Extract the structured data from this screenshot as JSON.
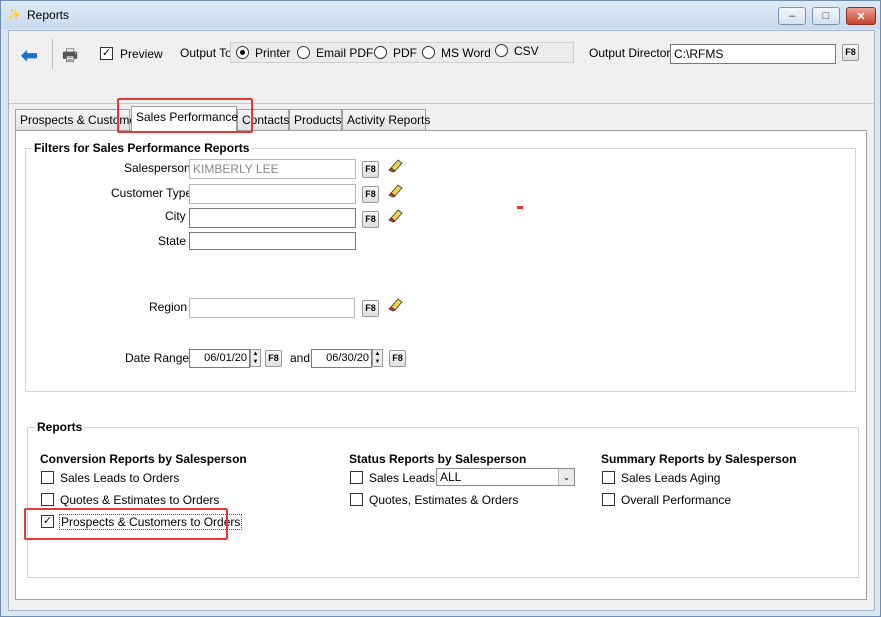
{
  "window": {
    "title": "Reports"
  },
  "toolbar": {
    "preview_label": "Preview",
    "preview_checked": true,
    "output_to_label": "Output To",
    "output_options": [
      "Printer",
      "Email PDF",
      "PDF",
      "MS Word",
      "CSV"
    ],
    "output_selected": "Printer",
    "output_dir_label": "Output Directory",
    "output_dir_value": "C:\\RFMS",
    "f8_label": "F8"
  },
  "tabs": [
    {
      "label": "Prospects & Customers"
    },
    {
      "label": "Sales Performance",
      "active": true
    },
    {
      "label": "Contacts"
    },
    {
      "label": "Products"
    },
    {
      "label": "Activity Reports"
    }
  ],
  "filters": {
    "title": "Filters for Sales Performance Reports",
    "salesperson_label": "Salesperson",
    "salesperson_value": "KIMBERLY LEE",
    "customer_type_label": "Customer Type",
    "customer_type_value": "",
    "city_label": "City",
    "city_value": "",
    "state_label": "State",
    "state_value": "",
    "region_label": "Region",
    "region_value": "",
    "date_range_label": "Date Range",
    "date_from": "06/01/20",
    "and_label": "and",
    "date_to": "06/30/20",
    "f8_label": "F8"
  },
  "reports": {
    "title": "Reports",
    "conversion": {
      "heading": "Conversion Reports by Salesperson",
      "items": [
        {
          "label": "Sales Leads to Orders",
          "checked": false
        },
        {
          "label": "Quotes & Estimates to Orders",
          "checked": false
        },
        {
          "label": "Prospects & Customers to Orders",
          "checked": true
        }
      ]
    },
    "status": {
      "heading": "Status Reports by Salesperson",
      "sales_leads_label": "Sales Leads",
      "sales_leads_checked": false,
      "sales_leads_filter": "ALL",
      "quotes_label": "Quotes, Estimates & Orders",
      "quotes_checked": false
    },
    "summary": {
      "heading": "Summary Reports by Salesperson",
      "items": [
        {
          "label": "Sales Leads Aging",
          "checked": false
        },
        {
          "label": "Overall Performance",
          "checked": false
        }
      ]
    }
  },
  "colors": {
    "highlight": "#e53935",
    "back_arrow": "#1e73c8"
  }
}
